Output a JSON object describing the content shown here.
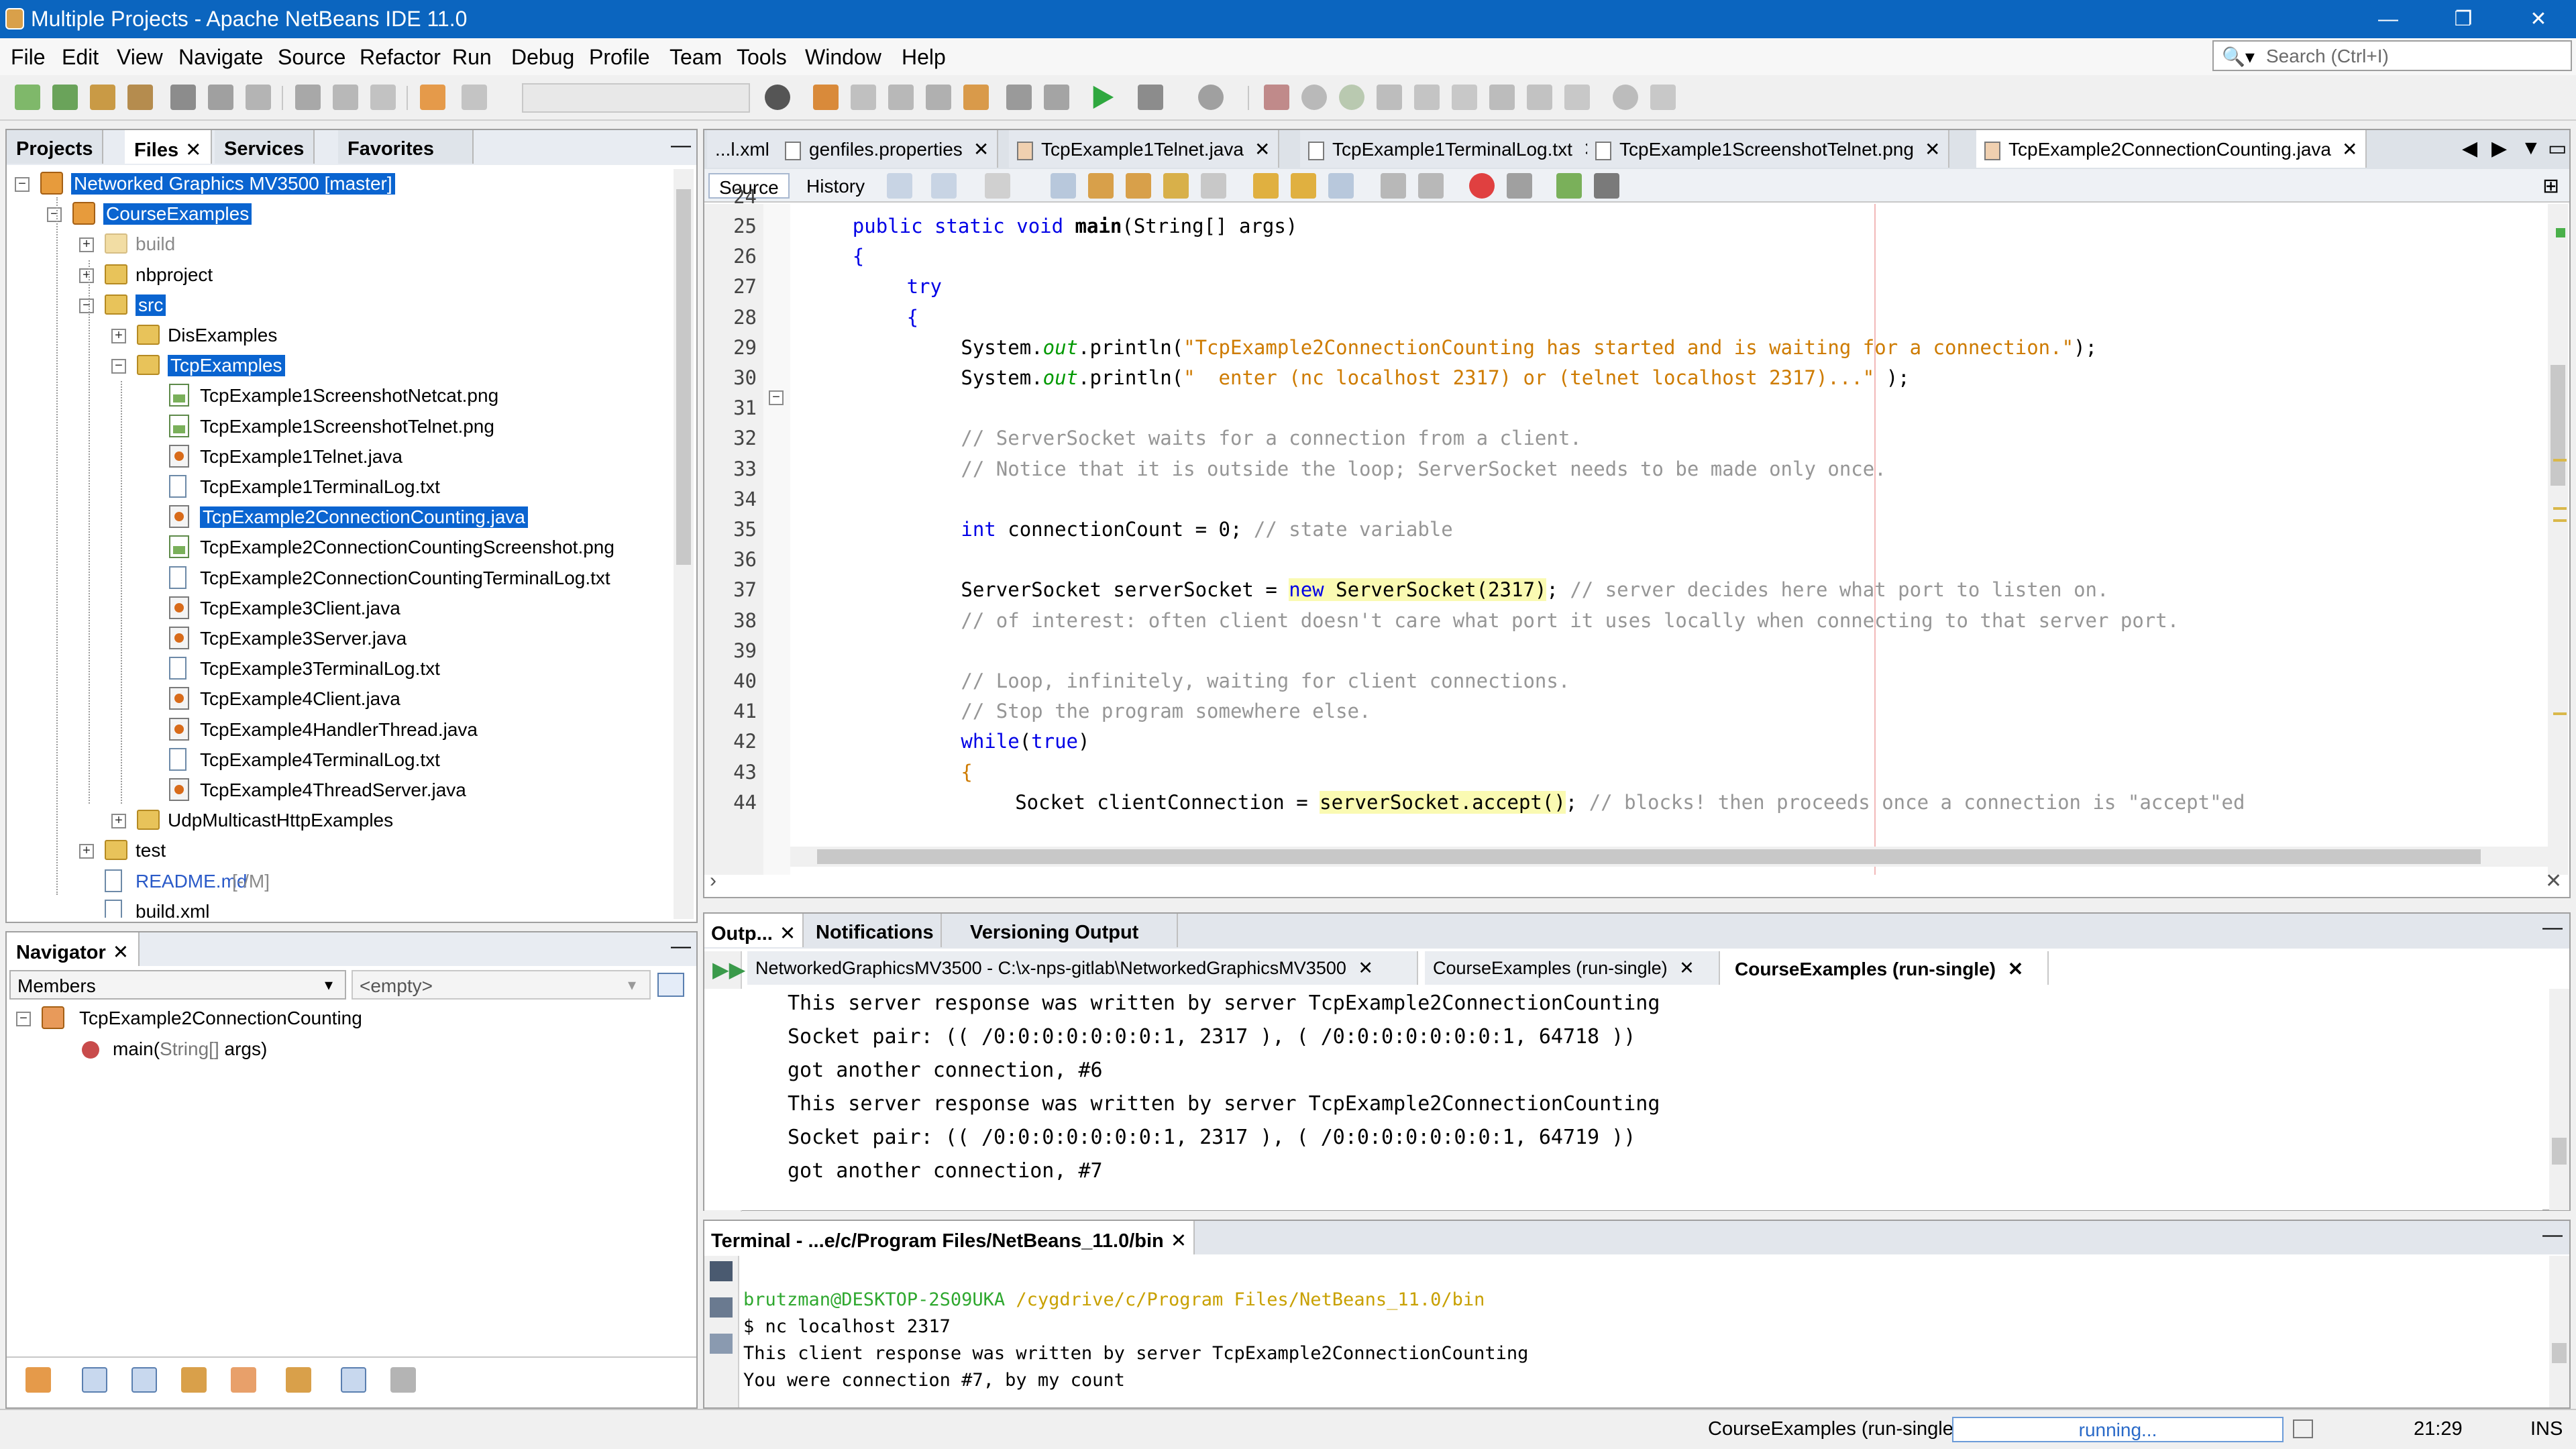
{
  "window": {
    "title": "Multiple Projects - Apache NetBeans IDE 11.0",
    "minimize": "—",
    "maximize": "❐",
    "close": "✕"
  },
  "menu": [
    "File",
    "Edit",
    "View",
    "Navigate",
    "Source",
    "Refactor",
    "Run",
    "Debug",
    "Profile",
    "Team",
    "Tools",
    "Window",
    "Help"
  ],
  "search": {
    "placeholder": "Search (Ctrl+I)"
  },
  "projects_panel": {
    "tabs": [
      "Projects",
      "Files",
      "Services",
      "Favorites"
    ],
    "active_tab": "Files",
    "tree": [
      {
        "label": "Networked Graphics MV3500 [master]",
        "level": 0,
        "type": "project",
        "selected": true
      },
      {
        "label": "CourseExamples",
        "level": 1,
        "type": "project",
        "selected": true
      },
      {
        "label": "build",
        "level": 2,
        "type": "folder",
        "dim": true
      },
      {
        "label": "nbproject",
        "level": 2,
        "type": "folder"
      },
      {
        "label": "src",
        "level": 2,
        "type": "folder",
        "selected": true
      },
      {
        "label": "DisExamples",
        "level": 3,
        "type": "folder"
      },
      {
        "label": "TcpExamples",
        "level": 3,
        "type": "folder",
        "selected": true
      },
      {
        "label": "TcpExample1ScreenshotNetcat.png",
        "level": 4,
        "type": "img"
      },
      {
        "label": "TcpExample1ScreenshotTelnet.png",
        "level": 4,
        "type": "img"
      },
      {
        "label": "TcpExample1Telnet.java",
        "level": 4,
        "type": "java"
      },
      {
        "label": "TcpExample1TerminalLog.txt",
        "level": 4,
        "type": "file"
      },
      {
        "label": "TcpExample2ConnectionCounting.java",
        "level": 4,
        "type": "java",
        "selected": true
      },
      {
        "label": "TcpExample2ConnectionCountingScreenshot.png",
        "level": 4,
        "type": "img"
      },
      {
        "label": "TcpExample2ConnectionCountingTerminalLog.txt",
        "level": 4,
        "type": "file"
      },
      {
        "label": "TcpExample3Client.java",
        "level": 4,
        "type": "java"
      },
      {
        "label": "TcpExample3Server.java",
        "level": 4,
        "type": "java"
      },
      {
        "label": "TcpExample3TerminalLog.txt",
        "level": 4,
        "type": "file"
      },
      {
        "label": "TcpExample4Client.java",
        "level": 4,
        "type": "java"
      },
      {
        "label": "TcpExample4HandlerThread.java",
        "level": 4,
        "type": "java"
      },
      {
        "label": "TcpExample4TerminalLog.txt",
        "level": 4,
        "type": "file"
      },
      {
        "label": "TcpExample4ThreadServer.java",
        "level": 4,
        "type": "java"
      },
      {
        "label": "UdpMulticastHttpExamples",
        "level": 3,
        "type": "folder"
      },
      {
        "label": "test",
        "level": 2,
        "type": "folder"
      },
      {
        "label": "README.md",
        "suffix": " [-/M]",
        "level": 2,
        "type": "file",
        "modified": true
      },
      {
        "label": "build.xml",
        "level": 2,
        "type": "file"
      }
    ]
  },
  "navigator": {
    "title": "Navigator",
    "filter": "Members",
    "filter2": "<empty>",
    "root": "TcpExample2ConnectionCounting",
    "method": "main(",
    "method_param": "String[]",
    "method_rest": " args)"
  },
  "editor": {
    "tabs": [
      {
        "label": "...l.xml",
        "active": false
      },
      {
        "label": "genfiles.properties",
        "active": false
      },
      {
        "label": "TcpExample1Telnet.java",
        "active": false
      },
      {
        "label": "TcpExample1TerminalLog.txt",
        "active": false
      },
      {
        "label": "TcpExample1ScreenshotTelnet.png",
        "active": false
      },
      {
        "label": "TcpExample2ConnectionCounting.java",
        "active": true
      }
    ],
    "source_label": "Source",
    "history_label": "History",
    "first_line": 24,
    "lines": [
      {
        "n": "25",
        "indent": 4,
        "parts": [
          [
            "kw",
            "public static void "
          ],
          [
            "meth",
            "main"
          ],
          [
            "",
            "(String[] args)"
          ]
        ]
      },
      {
        "n": "26",
        "indent": 4,
        "parts": [
          [
            "kw",
            "{"
          ]
        ]
      },
      {
        "n": "27",
        "indent": 8,
        "parts": [
          [
            "kw",
            "try"
          ]
        ]
      },
      {
        "n": "28",
        "indent": 8,
        "parts": [
          [
            "kw",
            "{"
          ]
        ]
      },
      {
        "n": "29",
        "indent": 12,
        "parts": [
          [
            "",
            "System."
          ],
          [
            "field",
            "out"
          ],
          [
            "",
            ".println("
          ],
          [
            "str",
            "\"TcpExample2ConnectionCounting has started and is waiting for a connection.\""
          ],
          [
            "",
            ");"
          ]
        ]
      },
      {
        "n": "30",
        "indent": 12,
        "parts": [
          [
            "",
            "System."
          ],
          [
            "field",
            "out"
          ],
          [
            "",
            ".println("
          ],
          [
            "str",
            "\"  enter (nc localhost 2317) or (telnet localhost 2317)...\""
          ],
          [
            "",
            " );"
          ]
        ]
      },
      {
        "n": "31",
        "indent": 0,
        "parts": []
      },
      {
        "n": "32",
        "indent": 12,
        "parts": [
          [
            "cmt",
            "// ServerSocket waits for a connection from a client."
          ]
        ]
      },
      {
        "n": "33",
        "indent": 12,
        "parts": [
          [
            "cmt",
            "// Notice that it is outside the loop; ServerSocket needs to be made only once."
          ]
        ]
      },
      {
        "n": "34",
        "indent": 0,
        "parts": []
      },
      {
        "n": "35",
        "indent": 12,
        "parts": [
          [
            "kw",
            "int"
          ],
          [
            "",
            " connectionCount = 0; "
          ],
          [
            "cmt",
            "// state variable"
          ]
        ]
      },
      {
        "n": "36",
        "indent": 0,
        "parts": []
      },
      {
        "n": "37",
        "indent": 12,
        "parts": [
          [
            "",
            "ServerSocket serverSocket = "
          ],
          [
            "hlkw",
            "new"
          ],
          [
            "hl",
            " ServerSocket(2317)"
          ],
          [
            "",
            "; "
          ],
          [
            "cmt",
            "// server decides here what port to listen on."
          ]
        ]
      },
      {
        "n": "38",
        "indent": 12,
        "parts": [
          [
            "cmt",
            "// of interest: often client doesn't care what port it uses locally when connecting to that server port."
          ]
        ]
      },
      {
        "n": "39",
        "indent": 0,
        "parts": []
      },
      {
        "n": "40",
        "indent": 12,
        "parts": [
          [
            "cmt",
            "// Loop, infinitely, waiting for client connections."
          ]
        ]
      },
      {
        "n": "41",
        "indent": 12,
        "parts": [
          [
            "cmt",
            "// Stop the program somewhere else."
          ]
        ]
      },
      {
        "n": "42",
        "indent": 12,
        "parts": [
          [
            "kw",
            "while"
          ],
          [
            "",
            "("
          ],
          [
            "kw",
            "true"
          ],
          [
            "",
            ")"
          ]
        ]
      },
      {
        "n": "43",
        "indent": 12,
        "parts": [
          [
            "str",
            "{"
          ]
        ]
      },
      {
        "n": "44",
        "indent": 16,
        "parts": [
          [
            "",
            "Socket clientConnection = "
          ],
          [
            "hl",
            "serverSocket.accept()"
          ],
          [
            "",
            "; "
          ],
          [
            "cmt",
            "// blocks! then proceeds once a connection is \"accept\"ed"
          ]
        ]
      }
    ]
  },
  "output": {
    "tabs": [
      "Outp...",
      "Notifications",
      "Versioning Output"
    ],
    "subtabs": [
      {
        "label": "NetworkedGraphicsMV3500 - C:\\x-nps-gitlab\\NetworkedGraphicsMV3500",
        "active": false
      },
      {
        "label": "CourseExamples (run-single)",
        "active": false
      },
      {
        "label": "CourseExamples (run-single)",
        "active": true
      }
    ],
    "lines": [
      "This server response was written by server TcpExample2ConnectionCounting",
      "Socket pair: (( /0:0:0:0:0:0:0:1, 2317 ), ( /0:0:0:0:0:0:0:1, 64718 ))",
      "got another connection, #6",
      "This server response was written by server TcpExample2ConnectionCounting",
      "Socket pair: (( /0:0:0:0:0:0:0:1, 2317 ), ( /0:0:0:0:0:0:0:1, 64719 ))",
      "got another connection, #7"
    ]
  },
  "terminal": {
    "title": "Terminal - ...e/c/Program Files/NetBeans_11.0/bin",
    "prompt_user": "brutzman@DESKTOP-2S09UKA",
    "prompt_path": " /cygdrive/c/Program Files/NetBeans_11.0/bin",
    "lines": [
      "$ nc localhost 2317",
      "This client response was written by server TcpExample2ConnectionCounting",
      "You were connection #7, by my count"
    ]
  },
  "status": {
    "task": "CourseExamples (run-single)",
    "progress_label": "running...",
    "position": "21:29",
    "mode": "INS"
  },
  "colors": {
    "titlebar": "#0b65bf",
    "selection": "#0a64d0",
    "keyword": "#0000e6",
    "string": "#ce7b00",
    "comment": "#969696",
    "field": "#009900",
    "highlight": "#fafab2",
    "terminal_user": "#2fa82f",
    "terminal_path": "#c8a000"
  }
}
